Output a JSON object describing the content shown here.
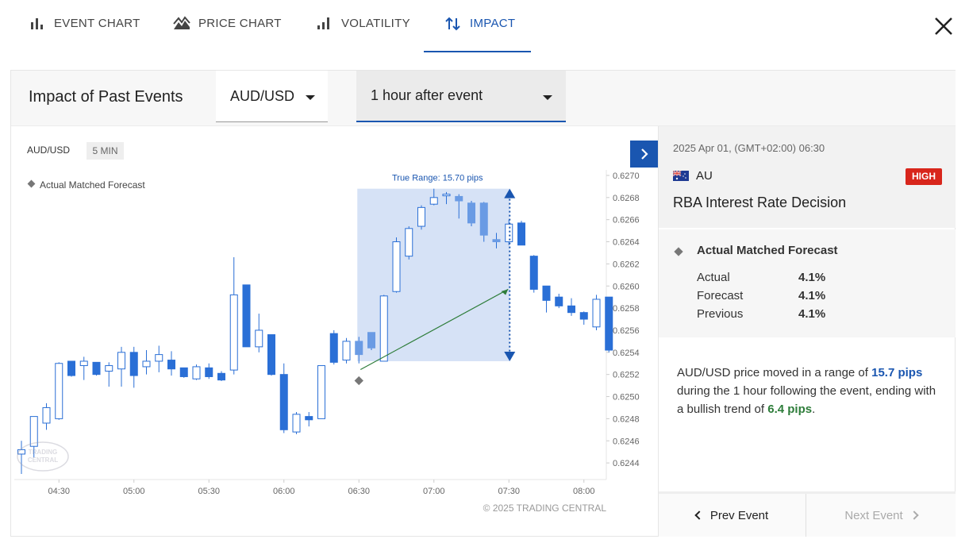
{
  "tabs": [
    {
      "label": "EVENT CHART",
      "icon": "bar-chart-icon"
    },
    {
      "label": "PRICE CHART",
      "icon": "mountain-chart-icon"
    },
    {
      "label": "VOLATILITY",
      "icon": "volatility-bars-icon"
    },
    {
      "label": "IMPACT",
      "icon": "up-down-arrows-icon",
      "active": true
    }
  ],
  "header": {
    "title": "Impact of Past Events",
    "pair_select": "AUD/USD",
    "window_select": "1 hour after event"
  },
  "chart": {
    "symbol": "AUD/USD",
    "interval": "5 MIN",
    "legend": "Actual Matched Forecast",
    "range_label": "True Range: 15.70 pips",
    "watermark": "TRADING CENTRAL",
    "copyright": "© 2025 TRADING CENTRAL",
    "colors": {
      "up_fill": "#ffffff",
      "up_stroke": "#2a6fd6",
      "down_fill": "#2a6fd6",
      "band": "#d6e2f6",
      "trend": "#2e7d3a",
      "range": "#1a56b0"
    }
  },
  "chart_data": {
    "type": "candlestick",
    "x_ticks": [
      "04:30",
      "05:00",
      "05:30",
      "06:00",
      "06:30",
      "07:00",
      "07:30",
      "08:00"
    ],
    "y_ticks": [
      "0.6270",
      "0.6268",
      "0.6266",
      "0.6264",
      "0.6262",
      "0.6260",
      "0.6258",
      "0.6256",
      "0.6254",
      "0.6252",
      "0.6250",
      "0.6248",
      "0.6246",
      "0.6244"
    ],
    "ylim": [
      0.62425,
      0.62705
    ],
    "event_time": "06:30",
    "event_price": 0.62523,
    "end_price": 0.62597,
    "range_low": 0.62532,
    "range_high": 0.62688,
    "candles": [
      {
        "t": "04:15",
        "o": 0.62448,
        "h": 0.6246,
        "l": 0.6243,
        "c": 0.62452
      },
      {
        "t": "04:20",
        "o": 0.62455,
        "h": 0.62472,
        "l": 0.62445,
        "c": 0.62482
      },
      {
        "t": "04:25",
        "o": 0.62476,
        "h": 0.62494,
        "l": 0.6247,
        "c": 0.6249
      },
      {
        "t": "04:30",
        "o": 0.6248,
        "h": 0.62531,
        "l": 0.62479,
        "c": 0.6253
      },
      {
        "t": "04:35",
        "o": 0.62532,
        "h": 0.62532,
        "l": 0.62518,
        "c": 0.62519
      },
      {
        "t": "04:40",
        "o": 0.62528,
        "h": 0.62536,
        "l": 0.62515,
        "c": 0.62532
      },
      {
        "t": "04:45",
        "o": 0.62531,
        "h": 0.62531,
        "l": 0.62519,
        "c": 0.6252
      },
      {
        "t": "04:50",
        "o": 0.62523,
        "h": 0.62531,
        "l": 0.62509,
        "c": 0.62528
      },
      {
        "t": "04:55",
        "o": 0.62525,
        "h": 0.62545,
        "l": 0.62509,
        "c": 0.6254
      },
      {
        "t": "05:00",
        "o": 0.6254,
        "h": 0.62545,
        "l": 0.62508,
        "c": 0.62519
      },
      {
        "t": "05:05",
        "o": 0.62527,
        "h": 0.62542,
        "l": 0.6252,
        "c": 0.62532
      },
      {
        "t": "05:10",
        "o": 0.62532,
        "h": 0.62546,
        "l": 0.62522,
        "c": 0.62538
      },
      {
        "t": "05:15",
        "o": 0.62533,
        "h": 0.62541,
        "l": 0.62519,
        "c": 0.62525
      },
      {
        "t": "05:20",
        "o": 0.62526,
        "h": 0.62526,
        "l": 0.62517,
        "c": 0.62518
      },
      {
        "t": "05:25",
        "o": 0.62516,
        "h": 0.62529,
        "l": 0.62515,
        "c": 0.62527
      },
      {
        "t": "05:30",
        "o": 0.62526,
        "h": 0.6253,
        "l": 0.62516,
        "c": 0.62518
      },
      {
        "t": "05:35",
        "o": 0.62521,
        "h": 0.62523,
        "l": 0.62514,
        "c": 0.62515
      },
      {
        "t": "05:40",
        "o": 0.62524,
        "h": 0.62626,
        "l": 0.6252,
        "c": 0.62592
      },
      {
        "t": "05:45",
        "o": 0.62601,
        "h": 0.62601,
        "l": 0.62545,
        "c": 0.62545
      },
      {
        "t": "05:50",
        "o": 0.62545,
        "h": 0.62575,
        "l": 0.6254,
        "c": 0.6256
      },
      {
        "t": "05:55",
        "o": 0.62556,
        "h": 0.62556,
        "l": 0.62519,
        "c": 0.6252
      },
      {
        "t": "06:00",
        "o": 0.6252,
        "h": 0.6253,
        "l": 0.62467,
        "c": 0.6247
      },
      {
        "t": "06:05",
        "o": 0.62468,
        "h": 0.62486,
        "l": 0.62466,
        "c": 0.62484
      },
      {
        "t": "06:10",
        "o": 0.62482,
        "h": 0.62486,
        "l": 0.62473,
        "c": 0.62479
      },
      {
        "t": "06:15",
        "o": 0.6248,
        "h": 0.62528,
        "l": 0.6248,
        "c": 0.62528
      },
      {
        "t": "06:20",
        "o": 0.62557,
        "h": 0.6256,
        "l": 0.62529,
        "c": 0.62531
      },
      {
        "t": "06:25",
        "o": 0.62533,
        "h": 0.62553,
        "l": 0.6253,
        "c": 0.6255
      },
      {
        "t": "06:30",
        "o": 0.6255,
        "h": 0.62554,
        "l": 0.6253,
        "c": 0.62538
      },
      {
        "t": "06:35",
        "o": 0.62558,
        "h": 0.62558,
        "l": 0.62542,
        "c": 0.62544
      },
      {
        "t": "06:40",
        "o": 0.62532,
        "h": 0.62592,
        "l": 0.62532,
        "c": 0.62591
      },
      {
        "t": "06:45",
        "o": 0.62595,
        "h": 0.62644,
        "l": 0.62594,
        "c": 0.6264
      },
      {
        "t": "06:50",
        "o": 0.62627,
        "h": 0.62654,
        "l": 0.62624,
        "c": 0.62652
      },
      {
        "t": "06:55",
        "o": 0.62654,
        "h": 0.62673,
        "l": 0.62651,
        "c": 0.62671
      },
      {
        "t": "07:00",
        "o": 0.62674,
        "h": 0.62688,
        "l": 0.62673,
        "c": 0.6268
      },
      {
        "t": "07:05",
        "o": 0.62683,
        "h": 0.62685,
        "l": 0.62674,
        "c": 0.62683
      },
      {
        "t": "07:10",
        "o": 0.62681,
        "h": 0.62683,
        "l": 0.62661,
        "c": 0.62677
      },
      {
        "t": "07:15",
        "o": 0.62675,
        "h": 0.62677,
        "l": 0.62654,
        "c": 0.62657
      },
      {
        "t": "07:20",
        "o": 0.62675,
        "h": 0.62676,
        "l": 0.6264,
        "c": 0.62646
      },
      {
        "t": "07:25",
        "o": 0.62642,
        "h": 0.62648,
        "l": 0.62634,
        "c": 0.6264
      },
      {
        "t": "07:30",
        "o": 0.6264,
        "h": 0.6266,
        "l": 0.62637,
        "c": 0.62656
      },
      {
        "t": "07:35",
        "o": 0.62657,
        "h": 0.62659,
        "l": 0.62637,
        "c": 0.62637
      },
      {
        "t": "07:40",
        "o": 0.62627,
        "h": 0.62628,
        "l": 0.62594,
        "c": 0.62597
      },
      {
        "t": "07:45",
        "o": 0.626,
        "h": 0.626,
        "l": 0.62576,
        "c": 0.62587
      },
      {
        "t": "07:50",
        "o": 0.6259,
        "h": 0.62593,
        "l": 0.6258,
        "c": 0.62582
      },
      {
        "t": "07:55",
        "o": 0.62582,
        "h": 0.62589,
        "l": 0.62573,
        "c": 0.62576
      },
      {
        "t": "08:00",
        "o": 0.62576,
        "h": 0.62577,
        "l": 0.62565,
        "c": 0.6257
      },
      {
        "t": "08:05",
        "o": 0.62563,
        "h": 0.62592,
        "l": 0.6256,
        "c": 0.62588
      },
      {
        "t": "08:10",
        "o": 0.6259,
        "h": 0.6259,
        "l": 0.6254,
        "c": 0.62542
      }
    ]
  },
  "event": {
    "date": "2025 Apr 01, (GMT+02:00) 06:30",
    "country": "AU",
    "impact": "HIGH",
    "name": "RBA Interest Rate Decision",
    "forecast_title": "Actual Matched Forecast",
    "rows": [
      {
        "label": "Actual",
        "value": "4.1%"
      },
      {
        "label": "Forecast",
        "value": "4.1%"
      },
      {
        "label": "Previous",
        "value": "4.1%"
      }
    ]
  },
  "summary": {
    "p1": "AUD/USD price moved in a range of ",
    "range": "15.7 pips",
    "p2": " during the 1 hour following the event, ending with a bullish trend of ",
    "trend": "6.4 pips",
    "p3": "."
  },
  "nav": {
    "prev": "Prev Event",
    "next": "Next Event"
  }
}
